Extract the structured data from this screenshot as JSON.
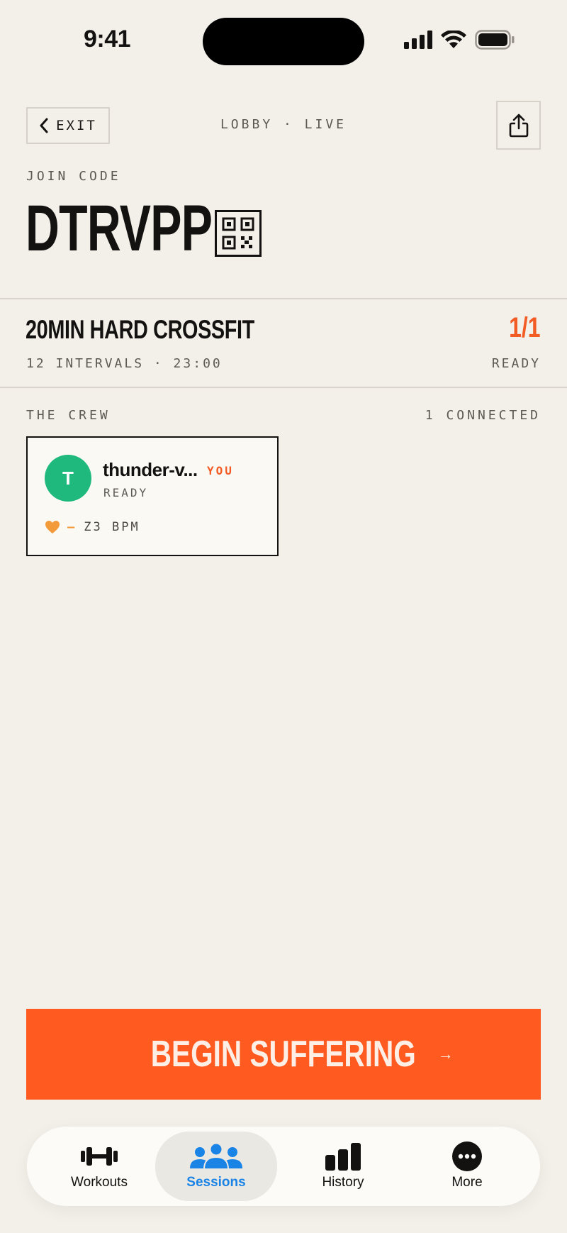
{
  "status_bar": {
    "time": "9:41"
  },
  "header": {
    "exit_label": "EXIT",
    "lobby_label": "LOBBY · LIVE"
  },
  "join": {
    "label": "JOIN CODE",
    "code": "DTRVPP"
  },
  "workout": {
    "title": "20MIN HARD CROSSFIT",
    "meta": "12 INTERVALS · 23:00",
    "ready_count": "1/1",
    "ready_label": "READY"
  },
  "crew": {
    "label": "THE CREW",
    "count": "1 CONNECTED",
    "members": [
      {
        "initial": "T",
        "name": "thunder-v...",
        "badge": "YOU",
        "status": "READY",
        "hr_value": "—",
        "hr_unit": "Z3 BPM"
      }
    ]
  },
  "cta": {
    "label": "BEGIN SUFFERING",
    "arrow": "→"
  },
  "tabbar": {
    "tabs": [
      {
        "label": "Workouts",
        "icon": "dumbbell-icon"
      },
      {
        "label": "Sessions",
        "icon": "people-icon",
        "active": true
      },
      {
        "label": "History",
        "icon": "bar-chart-icon"
      },
      {
        "label": "More",
        "icon": "more-icon"
      }
    ]
  },
  "colors": {
    "background": "#f3f0ea",
    "accent": "#ff5a1f",
    "active_tab": "#1a84e6",
    "avatar": "#1fb97e"
  }
}
